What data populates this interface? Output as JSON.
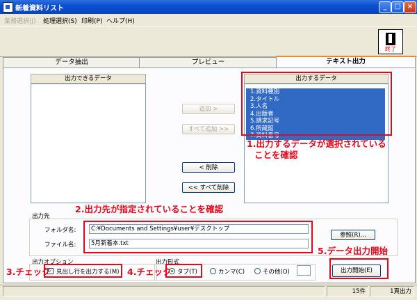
{
  "window": {
    "title": "新着資料リスト"
  },
  "menu": [
    {
      "label": "業務選択(J)",
      "disabled": true
    },
    {
      "label": "処理選択(S)",
      "disabled": false
    },
    {
      "label": "印刷(P)",
      "disabled": false
    },
    {
      "label": "ヘルプ(H)",
      "disabled": false
    }
  ],
  "toolbar": {
    "exit_label": "終了"
  },
  "tabs": [
    {
      "label": "データ抽出",
      "active": false
    },
    {
      "label": "プレビュー",
      "active": false
    },
    {
      "label": "テキスト出力",
      "active": true
    }
  ],
  "available": {
    "header": "出力できるデータ",
    "items": []
  },
  "output": {
    "header": "出力するデータ",
    "items": [
      "1.資料種別",
      "2.タイトル",
      "3.人名",
      "4.出版者",
      "5.請求記号",
      "6.所蔵館",
      "7.資料番号"
    ]
  },
  "buttons": {
    "add": "追加 >",
    "add_all": "すべて追加 >>",
    "remove": "< 削除",
    "remove_all": "<< すべて削除",
    "browse": "参照(R)...",
    "start": "出力開始(E)"
  },
  "destination": {
    "group_label": "出力先",
    "folder_label": "フォルダ名:",
    "folder_value": "C:¥Documents and Settings¥user¥デスクトップ",
    "file_label": "ファイル名:",
    "file_value": "5月新着本.txt"
  },
  "options": {
    "group_label": "出力オプション",
    "header_checkbox": "見出し行を出力する(M)",
    "header_checked": true
  },
  "format": {
    "group_label": "出力形式",
    "tab": "タブ(T)",
    "comma": "カンマ(C)",
    "other": "その他(O)",
    "selected": "tab",
    "other_value": ""
  },
  "annotations": {
    "n1_line1": "1.出力するデータが選択されている",
    "n1_line2": "ことを確認",
    "n2": "2.出力先が指定されていることを確認",
    "n3": "3.チェック",
    "n4": "4.チェック",
    "n5": "5.データ出力開始"
  },
  "status": {
    "count": "15件",
    "page": "1頁出力"
  },
  "colors": {
    "annotation": "#e3081b",
    "selection": "#316ac5",
    "titlebar": "#0a4fd1"
  }
}
